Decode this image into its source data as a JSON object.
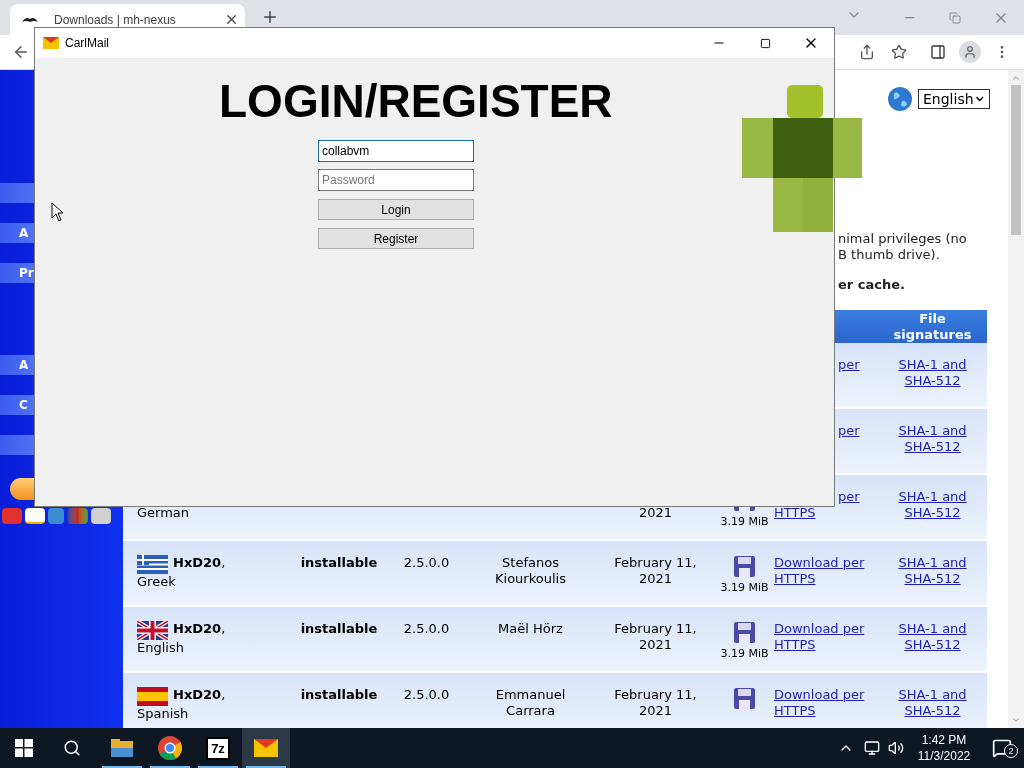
{
  "browser": {
    "tab": {
      "title": "Downloads | mh-nexus",
      "selected": true
    }
  },
  "page": {
    "sidebar": {
      "items": [
        {
          "kind": "blank"
        },
        {
          "kind": "link",
          "label": "A"
        },
        {
          "kind": "link",
          "label": "Pr"
        },
        {
          "kind": "link",
          "label": "A"
        },
        {
          "kind": "link",
          "label": "C"
        },
        {
          "kind": "blank"
        }
      ]
    },
    "language": {
      "value": "English"
    },
    "intro_lines": [
      "nimal privileges (no",
      "B thumb drive)."
    ],
    "note": "er cache.",
    "table": {
      "columns": [
        {
          "label": "File signatures"
        }
      ],
      "rows": [
        {
          "kind": "covered",
          "download": "per",
          "signature": "SHA-1 and SHA-512"
        },
        {
          "kind": "covered",
          "download": "per",
          "signature": "SHA-1 and SHA-512"
        },
        {
          "kind": "partial",
          "name": "German",
          "date": "2021",
          "size": "3.19 MiB",
          "download": "per HTTPS",
          "signature": "SHA-1 and SHA-512"
        },
        {
          "kind": "full",
          "flag": {
            "kind": "greece"
          },
          "name": "**HxD20**, Greek",
          "type": "installable",
          "version": "2.5.0.0",
          "author": "Stefanos Kiourkoulis",
          "date": "February 11, 2021",
          "size": "3.19 MiB",
          "download": "Download per HTTPS",
          "signature": "SHA-1 and SHA-512"
        },
        {
          "kind": "full",
          "flag": {
            "kind": "uk"
          },
          "name": "**HxD20**, English",
          "type": "installable",
          "version": "2.5.0.0",
          "author": "Maël Hörz",
          "date": "February 11, 2021",
          "size": "3.19 MiB",
          "download": "Download per HTTPS",
          "signature": "SHA-1 and SHA-512"
        },
        {
          "kind": "full",
          "flag": {
            "kind": "spain"
          },
          "name": "**HxD20**, Spanish",
          "type": "installable",
          "version": "2.5.0.0",
          "author": "Emmanuel Carrara",
          "date": "February 11, 2021",
          "download": "Download per HTTPS",
          "signature": "SHA-1 and SHA-512"
        }
      ]
    }
  },
  "app_window": {
    "title": "CarlMail",
    "heading": "LOGIN/REGISTER",
    "username": {
      "value": "collabvm",
      "focused": true
    },
    "password": {
      "placeholder": "Password"
    },
    "buttons": [
      "Login",
      "Register"
    ]
  },
  "taskbar": {
    "apps": [
      {
        "kind": "explorer",
        "running": true,
        "selected": false
      },
      {
        "kind": "chrome",
        "running": true,
        "selected": false
      },
      {
        "kind": "archiver",
        "label": "7z",
        "running": true,
        "selected": false
      },
      {
        "kind": "mail",
        "running": true,
        "selected": true
      }
    ],
    "time": "1:42 PM",
    "date": "11/3/2022",
    "notifications": "2"
  }
}
